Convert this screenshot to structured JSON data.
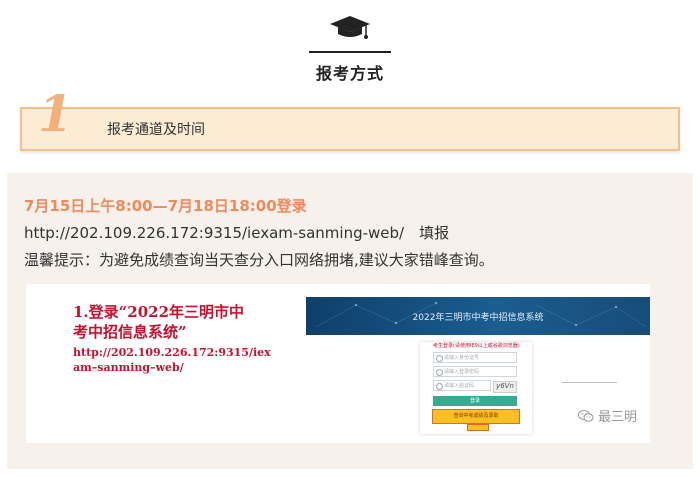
{
  "section": {
    "title": "报考方式",
    "icon": "graduation-cap-icon"
  },
  "step": {
    "number": "1",
    "label": "报考通道及时间"
  },
  "info": {
    "date_line": "7月15日上午8:00—7月18日18:00登录",
    "url_line": "http://202.109.226.172:9315/iexam-sanming-web/　填报",
    "tip_line": "温馨提示：为避免成绩查询当天查分入口网络拥堵,建议大家错峰查询。"
  },
  "screenshot": {
    "caption_title_lines": [
      "1.登录“2022年三明市中",
      "考中招信息系统”"
    ],
    "caption_url_lines": [
      "http://202.109.226.172:9315/iex",
      "am–sanming–web/"
    ],
    "site_title": "2022年三明市中考中招信息系统",
    "form": {
      "label": "考生登录(请使用IE9以上或谷歌浏览器)",
      "fields": [
        {
          "placeholder": "请输入身份证号"
        },
        {
          "placeholder": "请输入登录密码"
        },
        {
          "placeholder": "请输入验证码"
        }
      ],
      "captcha": "y6Vn",
      "login_button": "登录",
      "query_button": "查询中考成绩及录取"
    },
    "watermark": "最三明",
    "watermark_icon": "wechat-icon"
  },
  "colors": {
    "accent_orange": "#f08a5d",
    "banner_bg": "#fdecd4",
    "banner_border": "#f4c08c",
    "panel_bg": "#f6f1ea",
    "caption_red": "#c8102e"
  }
}
